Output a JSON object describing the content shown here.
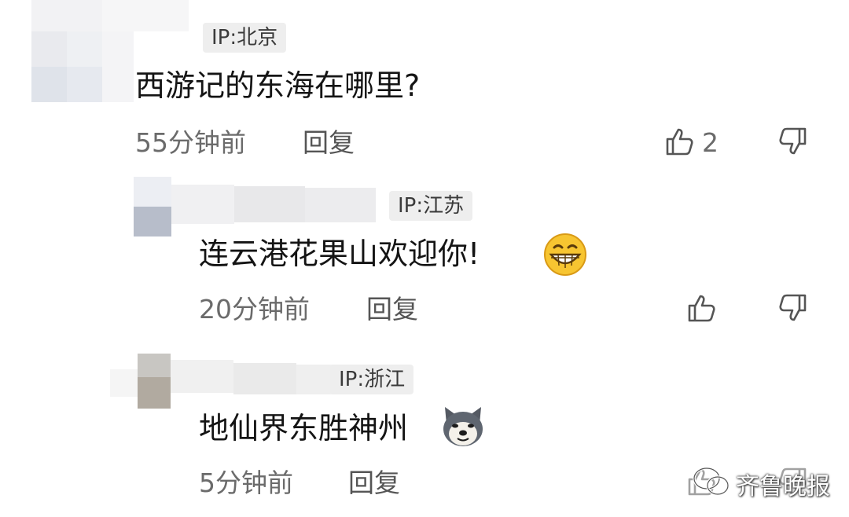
{
  "comments": [
    {
      "ip": "IP:北京",
      "text": "西游记的东海在哪里?",
      "time": "55分钟前",
      "reply_label": "回复",
      "like_count": "2"
    },
    {
      "ip": "IP:江苏",
      "text": "连云港花果山欢迎你!",
      "time": "20分钟前",
      "reply_label": "回复",
      "emoji": "grinning-face"
    },
    {
      "ip": "IP:浙江",
      "text": "地仙界东胜神州",
      "time": "5分钟前",
      "reply_label": "回复",
      "emoji": "doge-face"
    }
  ],
  "watermark": "齐鲁晚报",
  "icons": [
    "like-icon",
    "dislike-icon",
    "wechat-icon"
  ],
  "colors": {
    "ip_tag_bg": "#eeeeee",
    "meta_text": "#6b6b6b",
    "icon_stroke": "#444444"
  }
}
